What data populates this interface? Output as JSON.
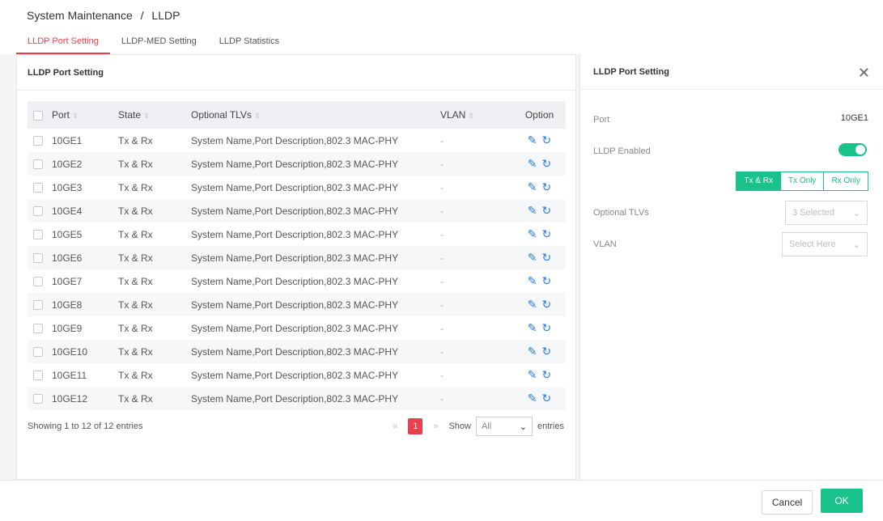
{
  "breadcrumb": [
    "System Maintenance",
    "/",
    "LLDP"
  ],
  "tabs": [
    "LLDP Port Setting",
    "LLDP-MED Setting",
    "LLDP Statistics"
  ],
  "panel_title": "LLDP Port Setting",
  "table": {
    "headers": [
      "Port",
      "State",
      "Optional TLVs",
      "VLAN",
      "Option"
    ],
    "rows": [
      {
        "port": "10GE1",
        "state": "Tx & Rx",
        "tlv": "System Name,Port Description,802.3 MAC-PHY",
        "vlan": "-"
      },
      {
        "port": "10GE2",
        "state": "Tx & Rx",
        "tlv": "System Name,Port Description,802.3 MAC-PHY",
        "vlan": "-"
      },
      {
        "port": "10GE3",
        "state": "Tx & Rx",
        "tlv": "System Name,Port Description,802.3 MAC-PHY",
        "vlan": "-"
      },
      {
        "port": "10GE4",
        "state": "Tx & Rx",
        "tlv": "System Name,Port Description,802.3 MAC-PHY",
        "vlan": "-"
      },
      {
        "port": "10GE5",
        "state": "Tx & Rx",
        "tlv": "System Name,Port Description,802.3 MAC-PHY",
        "vlan": "-"
      },
      {
        "port": "10GE6",
        "state": "Tx & Rx",
        "tlv": "System Name,Port Description,802.3 MAC-PHY",
        "vlan": "-"
      },
      {
        "port": "10GE7",
        "state": "Tx & Rx",
        "tlv": "System Name,Port Description,802.3 MAC-PHY",
        "vlan": "-"
      },
      {
        "port": "10GE8",
        "state": "Tx & Rx",
        "tlv": "System Name,Port Description,802.3 MAC-PHY",
        "vlan": "-"
      },
      {
        "port": "10GE9",
        "state": "Tx & Rx",
        "tlv": "System Name,Port Description,802.3 MAC-PHY",
        "vlan": "-"
      },
      {
        "port": "10GE10",
        "state": "Tx & Rx",
        "tlv": "System Name,Port Description,802.3 MAC-PHY",
        "vlan": "-"
      },
      {
        "port": "10GE11",
        "state": "Tx & Rx",
        "tlv": "System Name,Port Description,802.3 MAC-PHY",
        "vlan": "-"
      },
      {
        "port": "10GE12",
        "state": "Tx & Rx",
        "tlv": "System Name,Port Description,802.3 MAC-PHY",
        "vlan": "-"
      }
    ]
  },
  "footer": {
    "info": "Showing 1 to 12 of 12 entries",
    "prev": "«",
    "page": "1",
    "next": "»",
    "show": "Show",
    "page_size": "All",
    "entries": "entries"
  },
  "drawer": {
    "title": "LLDP Port Setting",
    "port_label": "Port",
    "port_value": "10GE1",
    "lldp_label": "LLDP Enabled",
    "lldp_enabled": true,
    "modes": [
      "Tx & Rx",
      "Tx Only",
      "Rx Only"
    ],
    "selected_mode": "Tx & Rx",
    "tlv_label": "Optional TLVs",
    "tlv_value": "3 Selected",
    "vlan_label": "VLAN",
    "vlan_placeholder": "Select Here"
  },
  "buttons": {
    "cancel": "Cancel",
    "ok": "OK"
  },
  "colors": {
    "accent_red": "#e9414b",
    "accent_green": "#1ac18a",
    "link_blue": "#2a7de1"
  }
}
